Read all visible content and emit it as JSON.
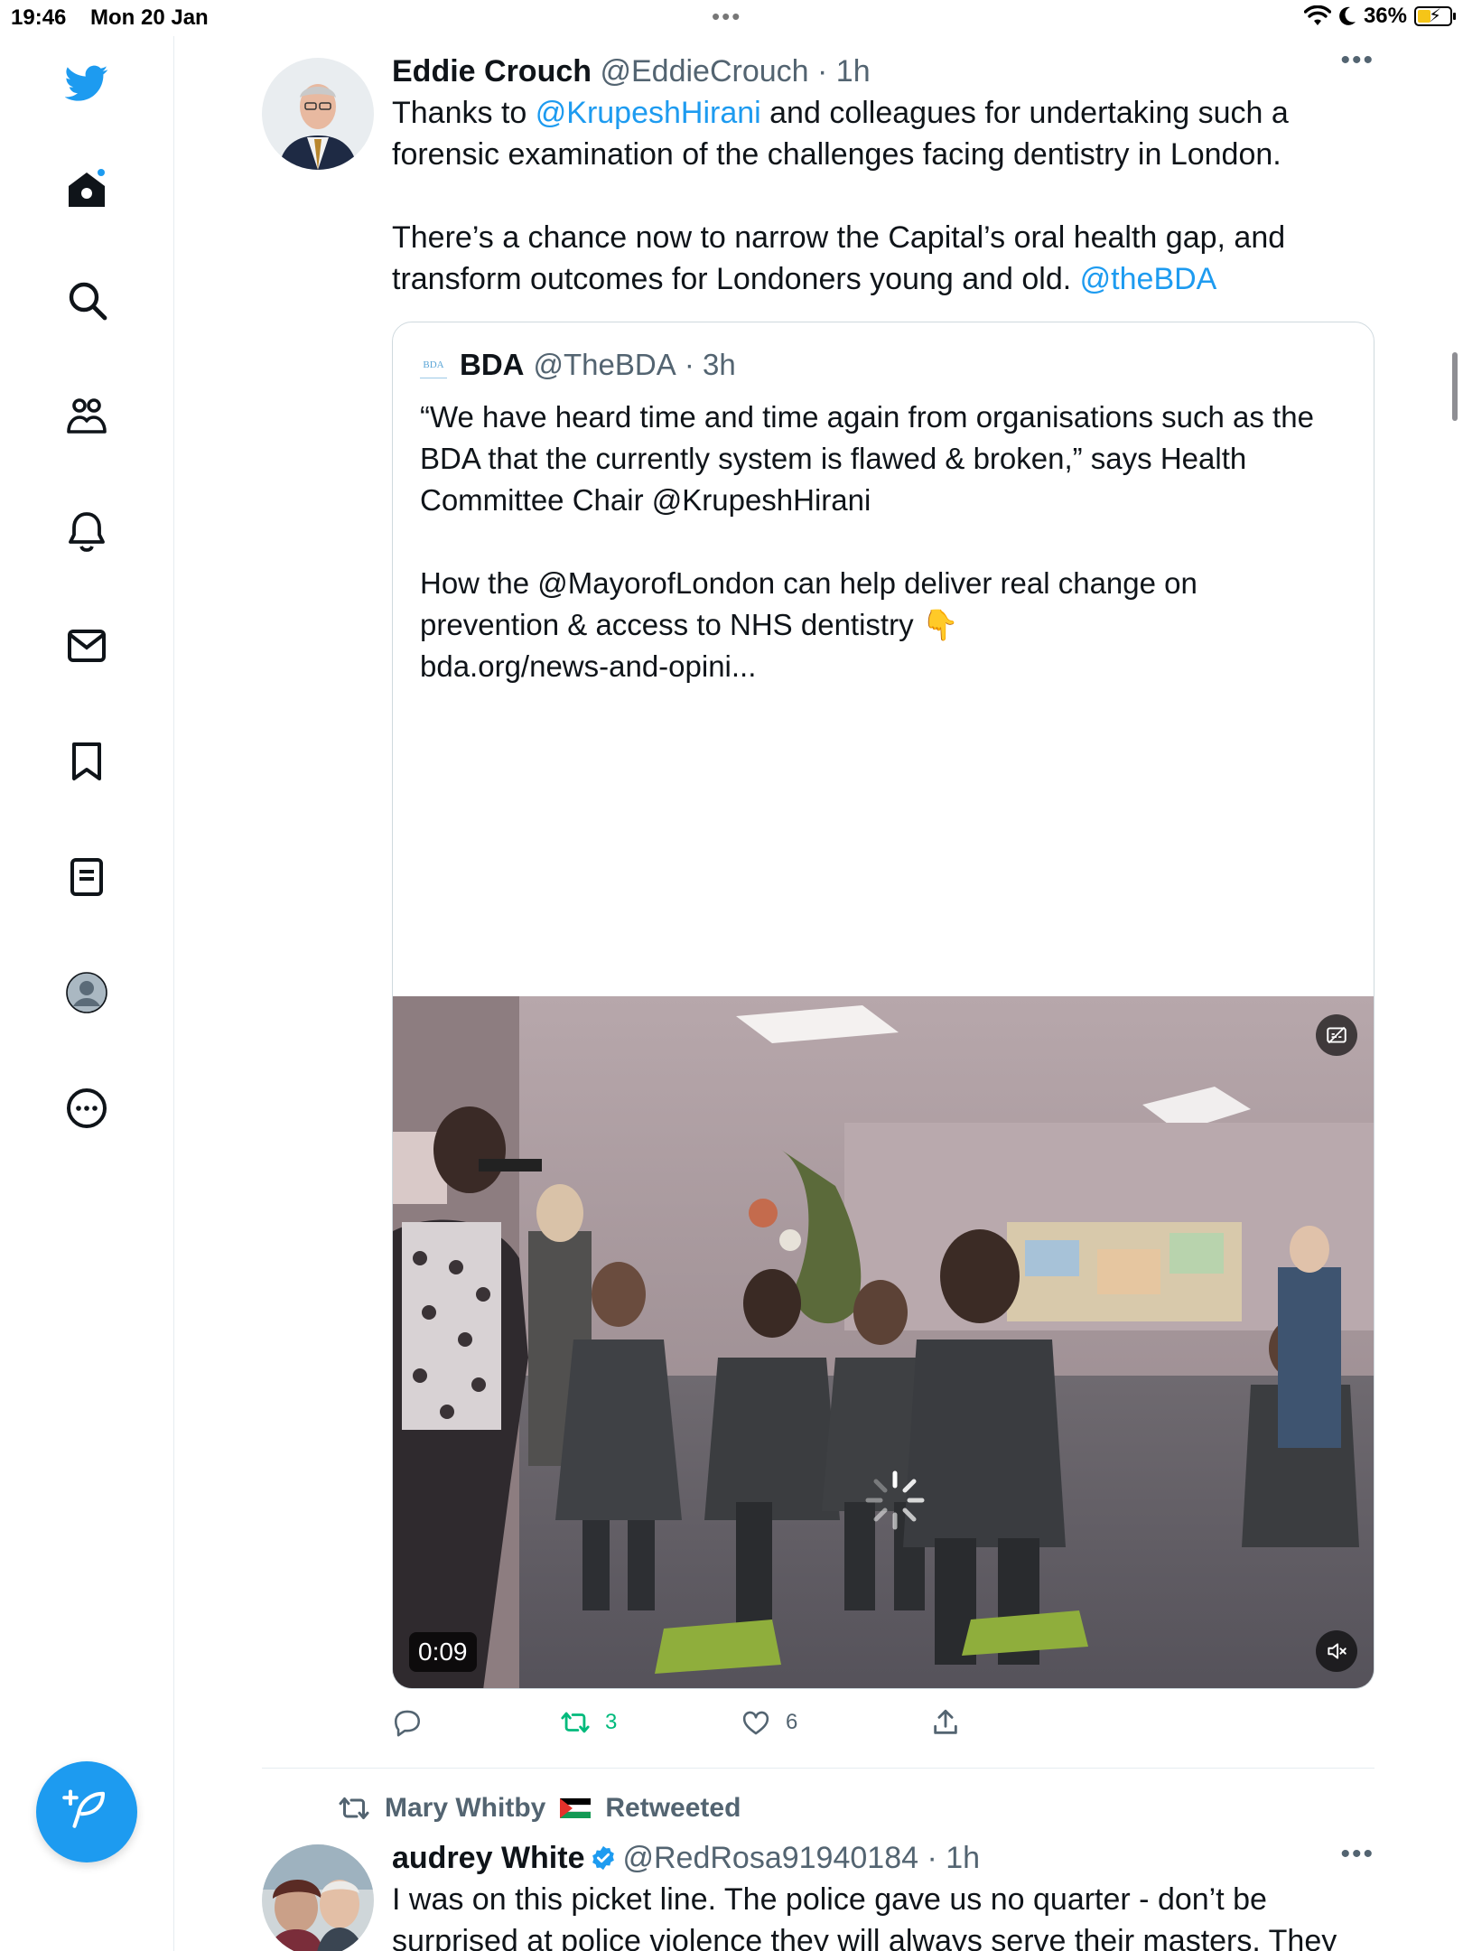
{
  "status_bar": {
    "time": "19:46",
    "date": "Mon 20 Jan",
    "battery": "36%"
  },
  "sidebar": {
    "items": [
      {
        "icon": "twitter-logo-icon"
      },
      {
        "icon": "home-icon"
      },
      {
        "icon": "search-icon"
      },
      {
        "icon": "communities-icon"
      },
      {
        "icon": "notifications-icon"
      },
      {
        "icon": "messages-icon"
      },
      {
        "icon": "bookmarks-icon"
      },
      {
        "icon": "lists-icon"
      },
      {
        "icon": "profile-icon"
      },
      {
        "icon": "more-icon"
      }
    ],
    "compose_icon": "compose-tweet-icon"
  },
  "tweet": {
    "name": "Eddie Crouch",
    "handle": "@EddieCrouch",
    "time": "· 1h",
    "text": {
      "l1_pre": "Thanks to ",
      "l1_link": "@KrupeshHirani",
      "l1_post": " and colleagues for undertaking such a",
      "l2": "forensic examination of the challenges facing dentistry in London.",
      "l3": "There’s a chance now to narrow the Capital’s oral health gap, and",
      "l4_pre": "transform outcomes for Londoners young and old. ",
      "l4_link": "@theBDA"
    },
    "quote": {
      "logo_text": "BDA",
      "name": "BDA",
      "handle": "@TheBDA",
      "time": "· 3h",
      "lines": [
        "“We have heard time and time again from organisations such as the",
        "BDA that the currently system is flawed & broken,” says Health",
        "Committee Chair @KrupeshHirani",
        "",
        "How the @MayorofLondon can help deliver real change on",
        "prevention & access to NHS dentistry 👇",
        "bda.org/news-and-opini..."
      ],
      "video": {
        "timer": "0:09"
      }
    },
    "actions": {
      "reply_count": "",
      "retweet_count": "3",
      "like_count": "6"
    }
  },
  "tweet2": {
    "retweeted_by": "Mary Whitby",
    "retweeted_label": "Retweeted",
    "name": "audrey White",
    "handle": "@RedRosa91940184",
    "time": "· 1h",
    "line1": "I was on this picket line. The police gave us no quarter - don’t be",
    "line2": "surprised at police violence they will always serve their masters. They"
  },
  "colors": {
    "accent": "#1d9bf0",
    "retweet_green": "#00ba7c",
    "secondary_text": "#536471",
    "border": "#cfd9de"
  }
}
